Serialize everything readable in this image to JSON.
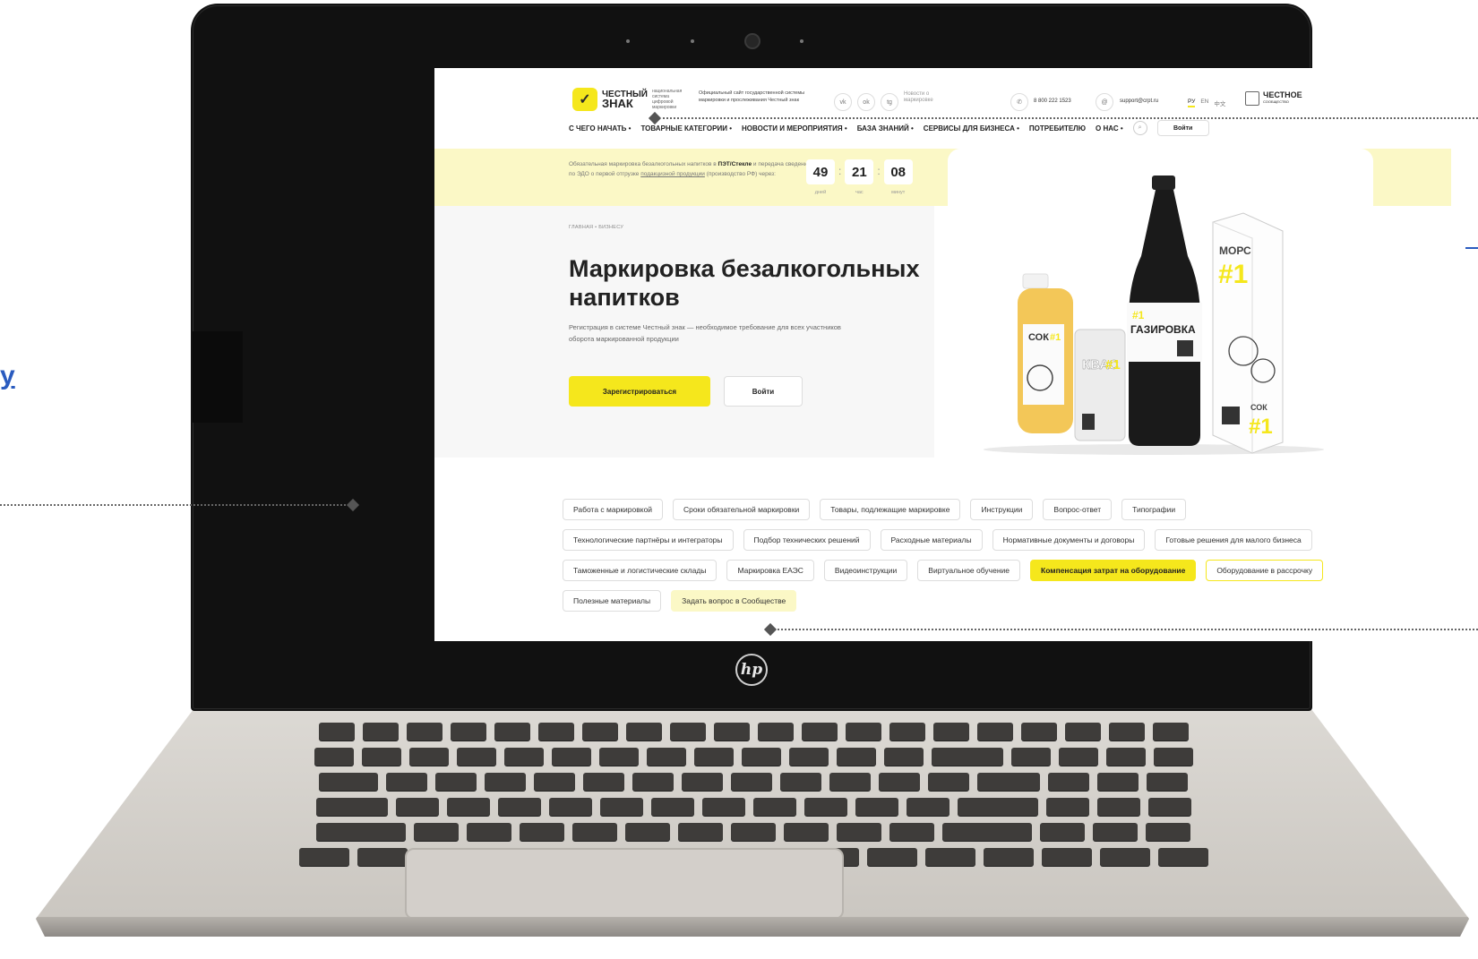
{
  "site": {
    "logo_mark": "✓",
    "logo_name_1": "ЧЕСТНЫЙ",
    "logo_name_2": "ЗНАК",
    "logo_sub": "национальная система цифровой маркировки",
    "official_text": "Официальный сайт государственной системы маркировки и прослеживания Честный знак",
    "social_icons": [
      "vk-icon",
      "ok-icon",
      "telegram-icon"
    ],
    "social_labels": [
      "vk",
      "ok",
      "tg"
    ],
    "news_label": "Новости о маркировке",
    "phone": "8 800 222 1523",
    "email": "support@crpt.ru",
    "languages": [
      "РУ",
      "EN",
      "中文"
    ],
    "community_title": "ЧЕСТНОЕ",
    "community_sub": "СООБЩЕСТВО"
  },
  "nav": {
    "items": [
      "С ЧЕГО НАЧАТЬ •",
      "ТОВАРНЫЕ КАТЕГОРИИ •",
      "НОВОСТИ И МЕРОПРИЯТИЯ •",
      "БАЗА ЗНАНИЙ •",
      "СЕРВИСЫ ДЛЯ БИЗНЕСА •",
      "ПОТРЕБИТЕЛЮ",
      "О НАС •"
    ],
    "login": "Войти"
  },
  "banner": {
    "text_1": "Обязательная маркировка безалкогольных напитков в",
    "text_bold": "ПЭТ/Стекле",
    "text_2": "и передача сведений по ЭДО о первой отгрузке",
    "text_link": "подакцизной продукции",
    "text_3": "(производство РФ) через:",
    "timer": [
      {
        "value": "49",
        "label": "дней"
      },
      {
        "value": "21",
        "label": "час"
      },
      {
        "value": "08",
        "label": "минут"
      }
    ]
  },
  "hero": {
    "breadcrumb": "ГЛАВНАЯ • БИЗНЕСУ",
    "title": "Маркировка безалкогольных напитков",
    "lead": "Регистрация в системе Честный знак — необходимое требование для всех участников оборота маркированной продукции",
    "register_button": "Зарегистрироваться",
    "login_button": "Войти",
    "product_labels": {
      "mors": "МОРС",
      "mors_num": "#1",
      "gaz_num": "#1",
      "gaz": "ГАЗИРОВКА",
      "kvas": "КВАС",
      "kvas_num": "#1",
      "sok": "СОК",
      "sok_num": "#1",
      "sok_carton": "СОК",
      "sok_carton_num": "#1"
    }
  },
  "tags": [
    {
      "label": "Работа с маркировкой",
      "style": "default"
    },
    {
      "label": "Сроки обязательной маркировки",
      "style": "default"
    },
    {
      "label": "Товары, подлежащие маркировке",
      "style": "default"
    },
    {
      "label": "Инструкции",
      "style": "default"
    },
    {
      "label": "Вопрос-ответ",
      "style": "default"
    },
    {
      "label": "Типографии",
      "style": "default"
    },
    {
      "label": "Технологические партнёры и интеграторы",
      "style": "default"
    },
    {
      "label": "Подбор технических решений",
      "style": "default"
    },
    {
      "label": "Расходные материалы",
      "style": "default"
    },
    {
      "label": "Нормативные документы и договоры",
      "style": "default"
    },
    {
      "label": "Готовые решения для малого бизнеса",
      "style": "default"
    },
    {
      "label": "Таможенные и логистические склады",
      "style": "default"
    },
    {
      "label": "Маркировка ЕАЭС",
      "style": "default"
    },
    {
      "label": "Видеоинструкции",
      "style": "default"
    },
    {
      "label": "Виртуальное обучение",
      "style": "default"
    },
    {
      "label": "Компенсация затрат на оборудование",
      "style": "yellow"
    },
    {
      "label": "Оборудование в рассрочку",
      "style": "outlined"
    },
    {
      "label": "Полезные материалы",
      "style": "default"
    },
    {
      "label": "Задать вопрос в Сообществе",
      "style": "soft"
    }
  ],
  "laptop": {
    "brand": "hp"
  },
  "page_fragment": {
    "left_text": "у"
  },
  "colors": {
    "accent": "#f5e71c",
    "banner_bg": "#fbf8c6",
    "link_blue": "#2a5bbf"
  }
}
